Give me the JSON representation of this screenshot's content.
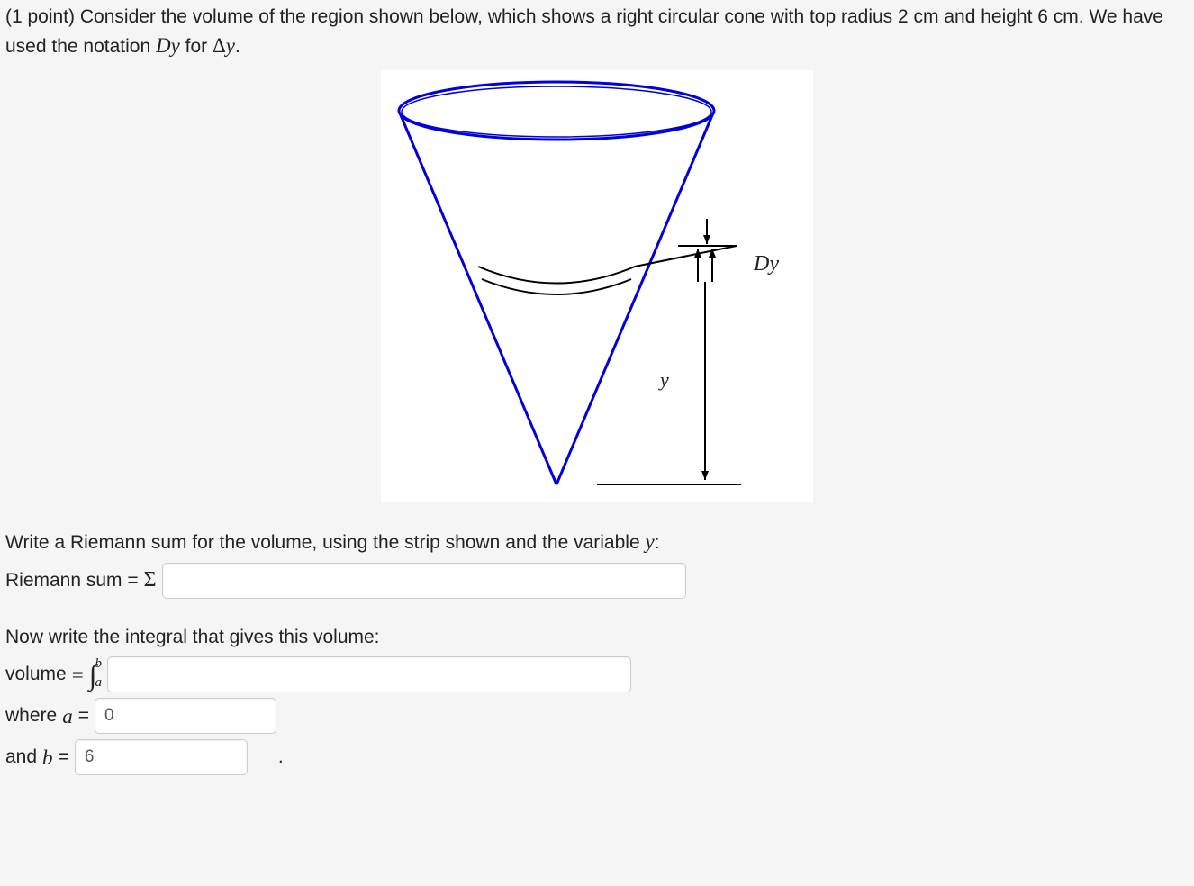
{
  "problem": {
    "points_prefix": "(1 point) ",
    "text_part1": "Consider the volume of the region shown below, which shows a right circular cone with top radius 2 cm and height 6 cm. We have used the notation ",
    "text_Dy_italic": "Dy",
    "text_for": " for ",
    "text_delta": "Δ",
    "text_y": "y",
    "text_period": "."
  },
  "figure": {
    "label_Dy": "Dy",
    "label_y": "y"
  },
  "riemann": {
    "instruction_part1": "Write a Riemann sum for the volume, using the strip shown and the variable ",
    "instruction_var": "y",
    "instruction_colon": ":",
    "label": "Riemann sum = ",
    "sigma": "Σ",
    "input_value": ""
  },
  "integral": {
    "instruction": "Now write the integral that gives this volume:",
    "volume_label": "volume ",
    "equals": "=",
    "bound_upper": "b",
    "bound_lower": "a",
    "integrand_value": "",
    "where_a_label": "where ",
    "a_symbol": "a",
    "a_equals": " = ",
    "a_value": "0",
    "and_b_label": "and ",
    "b_symbol": "b",
    "b_equals": " = ",
    "b_value": "6",
    "trailing_period": "."
  }
}
